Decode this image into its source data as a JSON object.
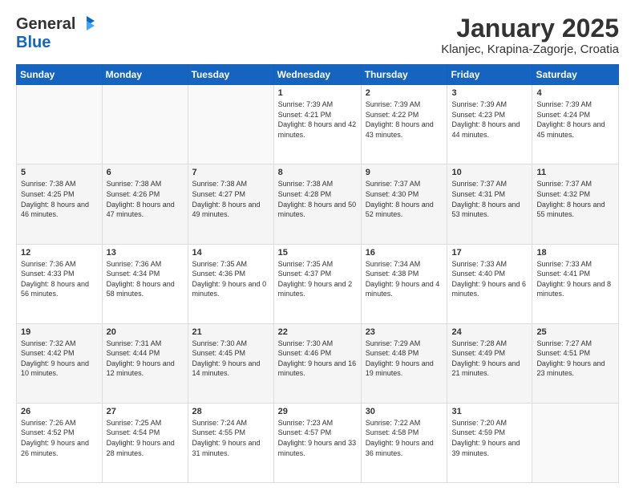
{
  "logo": {
    "general": "General",
    "blue": "Blue"
  },
  "header": {
    "title": "January 2025",
    "location": "Klanjec, Krapina-Zagorje, Croatia"
  },
  "days_header": [
    "Sunday",
    "Monday",
    "Tuesday",
    "Wednesday",
    "Thursday",
    "Friday",
    "Saturday"
  ],
  "weeks": [
    [
      {
        "day": "",
        "info": ""
      },
      {
        "day": "",
        "info": ""
      },
      {
        "day": "",
        "info": ""
      },
      {
        "day": "1",
        "info": "Sunrise: 7:39 AM\nSunset: 4:21 PM\nDaylight: 8 hours and 42 minutes."
      },
      {
        "day": "2",
        "info": "Sunrise: 7:39 AM\nSunset: 4:22 PM\nDaylight: 8 hours and 43 minutes."
      },
      {
        "day": "3",
        "info": "Sunrise: 7:39 AM\nSunset: 4:23 PM\nDaylight: 8 hours and 44 minutes."
      },
      {
        "day": "4",
        "info": "Sunrise: 7:39 AM\nSunset: 4:24 PM\nDaylight: 8 hours and 45 minutes."
      }
    ],
    [
      {
        "day": "5",
        "info": "Sunrise: 7:38 AM\nSunset: 4:25 PM\nDaylight: 8 hours and 46 minutes."
      },
      {
        "day": "6",
        "info": "Sunrise: 7:38 AM\nSunset: 4:26 PM\nDaylight: 8 hours and 47 minutes."
      },
      {
        "day": "7",
        "info": "Sunrise: 7:38 AM\nSunset: 4:27 PM\nDaylight: 8 hours and 49 minutes."
      },
      {
        "day": "8",
        "info": "Sunrise: 7:38 AM\nSunset: 4:28 PM\nDaylight: 8 hours and 50 minutes."
      },
      {
        "day": "9",
        "info": "Sunrise: 7:37 AM\nSunset: 4:30 PM\nDaylight: 8 hours and 52 minutes."
      },
      {
        "day": "10",
        "info": "Sunrise: 7:37 AM\nSunset: 4:31 PM\nDaylight: 8 hours and 53 minutes."
      },
      {
        "day": "11",
        "info": "Sunrise: 7:37 AM\nSunset: 4:32 PM\nDaylight: 8 hours and 55 minutes."
      }
    ],
    [
      {
        "day": "12",
        "info": "Sunrise: 7:36 AM\nSunset: 4:33 PM\nDaylight: 8 hours and 56 minutes."
      },
      {
        "day": "13",
        "info": "Sunrise: 7:36 AM\nSunset: 4:34 PM\nDaylight: 8 hours and 58 minutes."
      },
      {
        "day": "14",
        "info": "Sunrise: 7:35 AM\nSunset: 4:36 PM\nDaylight: 9 hours and 0 minutes."
      },
      {
        "day": "15",
        "info": "Sunrise: 7:35 AM\nSunset: 4:37 PM\nDaylight: 9 hours and 2 minutes."
      },
      {
        "day": "16",
        "info": "Sunrise: 7:34 AM\nSunset: 4:38 PM\nDaylight: 9 hours and 4 minutes."
      },
      {
        "day": "17",
        "info": "Sunrise: 7:33 AM\nSunset: 4:40 PM\nDaylight: 9 hours and 6 minutes."
      },
      {
        "day": "18",
        "info": "Sunrise: 7:33 AM\nSunset: 4:41 PM\nDaylight: 9 hours and 8 minutes."
      }
    ],
    [
      {
        "day": "19",
        "info": "Sunrise: 7:32 AM\nSunset: 4:42 PM\nDaylight: 9 hours and 10 minutes."
      },
      {
        "day": "20",
        "info": "Sunrise: 7:31 AM\nSunset: 4:44 PM\nDaylight: 9 hours and 12 minutes."
      },
      {
        "day": "21",
        "info": "Sunrise: 7:30 AM\nSunset: 4:45 PM\nDaylight: 9 hours and 14 minutes."
      },
      {
        "day": "22",
        "info": "Sunrise: 7:30 AM\nSunset: 4:46 PM\nDaylight: 9 hours and 16 minutes."
      },
      {
        "day": "23",
        "info": "Sunrise: 7:29 AM\nSunset: 4:48 PM\nDaylight: 9 hours and 19 minutes."
      },
      {
        "day": "24",
        "info": "Sunrise: 7:28 AM\nSunset: 4:49 PM\nDaylight: 9 hours and 21 minutes."
      },
      {
        "day": "25",
        "info": "Sunrise: 7:27 AM\nSunset: 4:51 PM\nDaylight: 9 hours and 23 minutes."
      }
    ],
    [
      {
        "day": "26",
        "info": "Sunrise: 7:26 AM\nSunset: 4:52 PM\nDaylight: 9 hours and 26 minutes."
      },
      {
        "day": "27",
        "info": "Sunrise: 7:25 AM\nSunset: 4:54 PM\nDaylight: 9 hours and 28 minutes."
      },
      {
        "day": "28",
        "info": "Sunrise: 7:24 AM\nSunset: 4:55 PM\nDaylight: 9 hours and 31 minutes."
      },
      {
        "day": "29",
        "info": "Sunrise: 7:23 AM\nSunset: 4:57 PM\nDaylight: 9 hours and 33 minutes."
      },
      {
        "day": "30",
        "info": "Sunrise: 7:22 AM\nSunset: 4:58 PM\nDaylight: 9 hours and 36 minutes."
      },
      {
        "day": "31",
        "info": "Sunrise: 7:20 AM\nSunset: 4:59 PM\nDaylight: 9 hours and 39 minutes."
      },
      {
        "day": "",
        "info": ""
      }
    ]
  ]
}
